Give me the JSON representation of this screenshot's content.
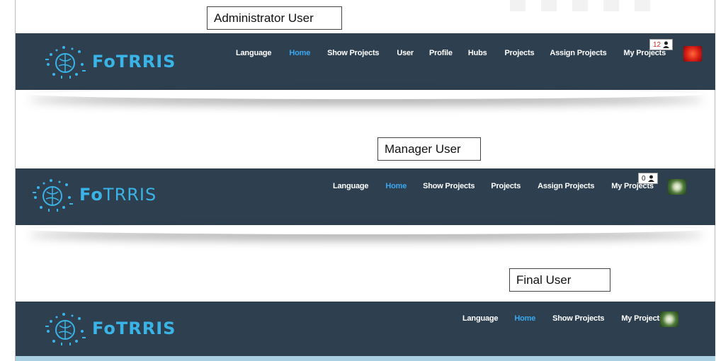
{
  "brand": {
    "part1": "Fo",
    "part2": "TRRIS"
  },
  "colors": {
    "navbar": "#2e3f50",
    "active": "#3aa8f0",
    "brand": "#3ab3e6",
    "badge_count": "#d32424"
  },
  "sections": [
    {
      "label": "Administrator User",
      "nav_items": [
        "Language",
        "Home",
        "Show Projects",
        "User",
        "Profile",
        "Hubs",
        "Projects",
        "Assign Projects",
        "My Projects"
      ],
      "active_item": "Home",
      "badge_count": "12",
      "badge_icon": "user-icon",
      "avatar": "red-flower-avatar"
    },
    {
      "label": "Manager User",
      "nav_items": [
        "Language",
        "Home",
        "Show Projects",
        "Projects",
        "Assign Projects",
        "My Projects"
      ],
      "active_item": "Home",
      "badge_count": "0",
      "badge_icon": "user-icon",
      "avatar": "white-flower-avatar"
    },
    {
      "label": "Final User",
      "nav_items": [
        "Language",
        "Home",
        "Show Projects",
        "My Projects"
      ],
      "active_item": "Home",
      "avatar": "white-flower-avatar"
    }
  ]
}
